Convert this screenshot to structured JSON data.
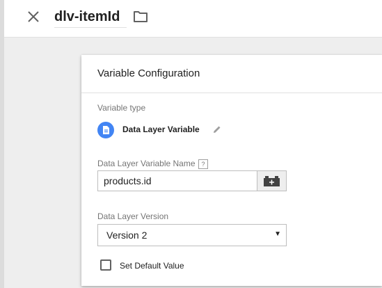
{
  "header": {
    "title": "dlv-itemId",
    "close_icon": "close-icon",
    "folder_icon": "folder-icon"
  },
  "card": {
    "title": "Variable Configuration",
    "variable_type": {
      "label": "Variable type",
      "name": "Data Layer Variable",
      "icon": "document-icon",
      "icon_color": "#4285f4",
      "edit_icon": "pencil-icon"
    },
    "variable_name": {
      "label": "Data Layer Variable Name",
      "help": "?",
      "value": "products.id",
      "picker_icon": "add-variable-icon"
    },
    "version": {
      "label": "Data Layer Version",
      "selected": "Version 2"
    },
    "default_value": {
      "label": "Set Default Value",
      "checked": false
    }
  }
}
